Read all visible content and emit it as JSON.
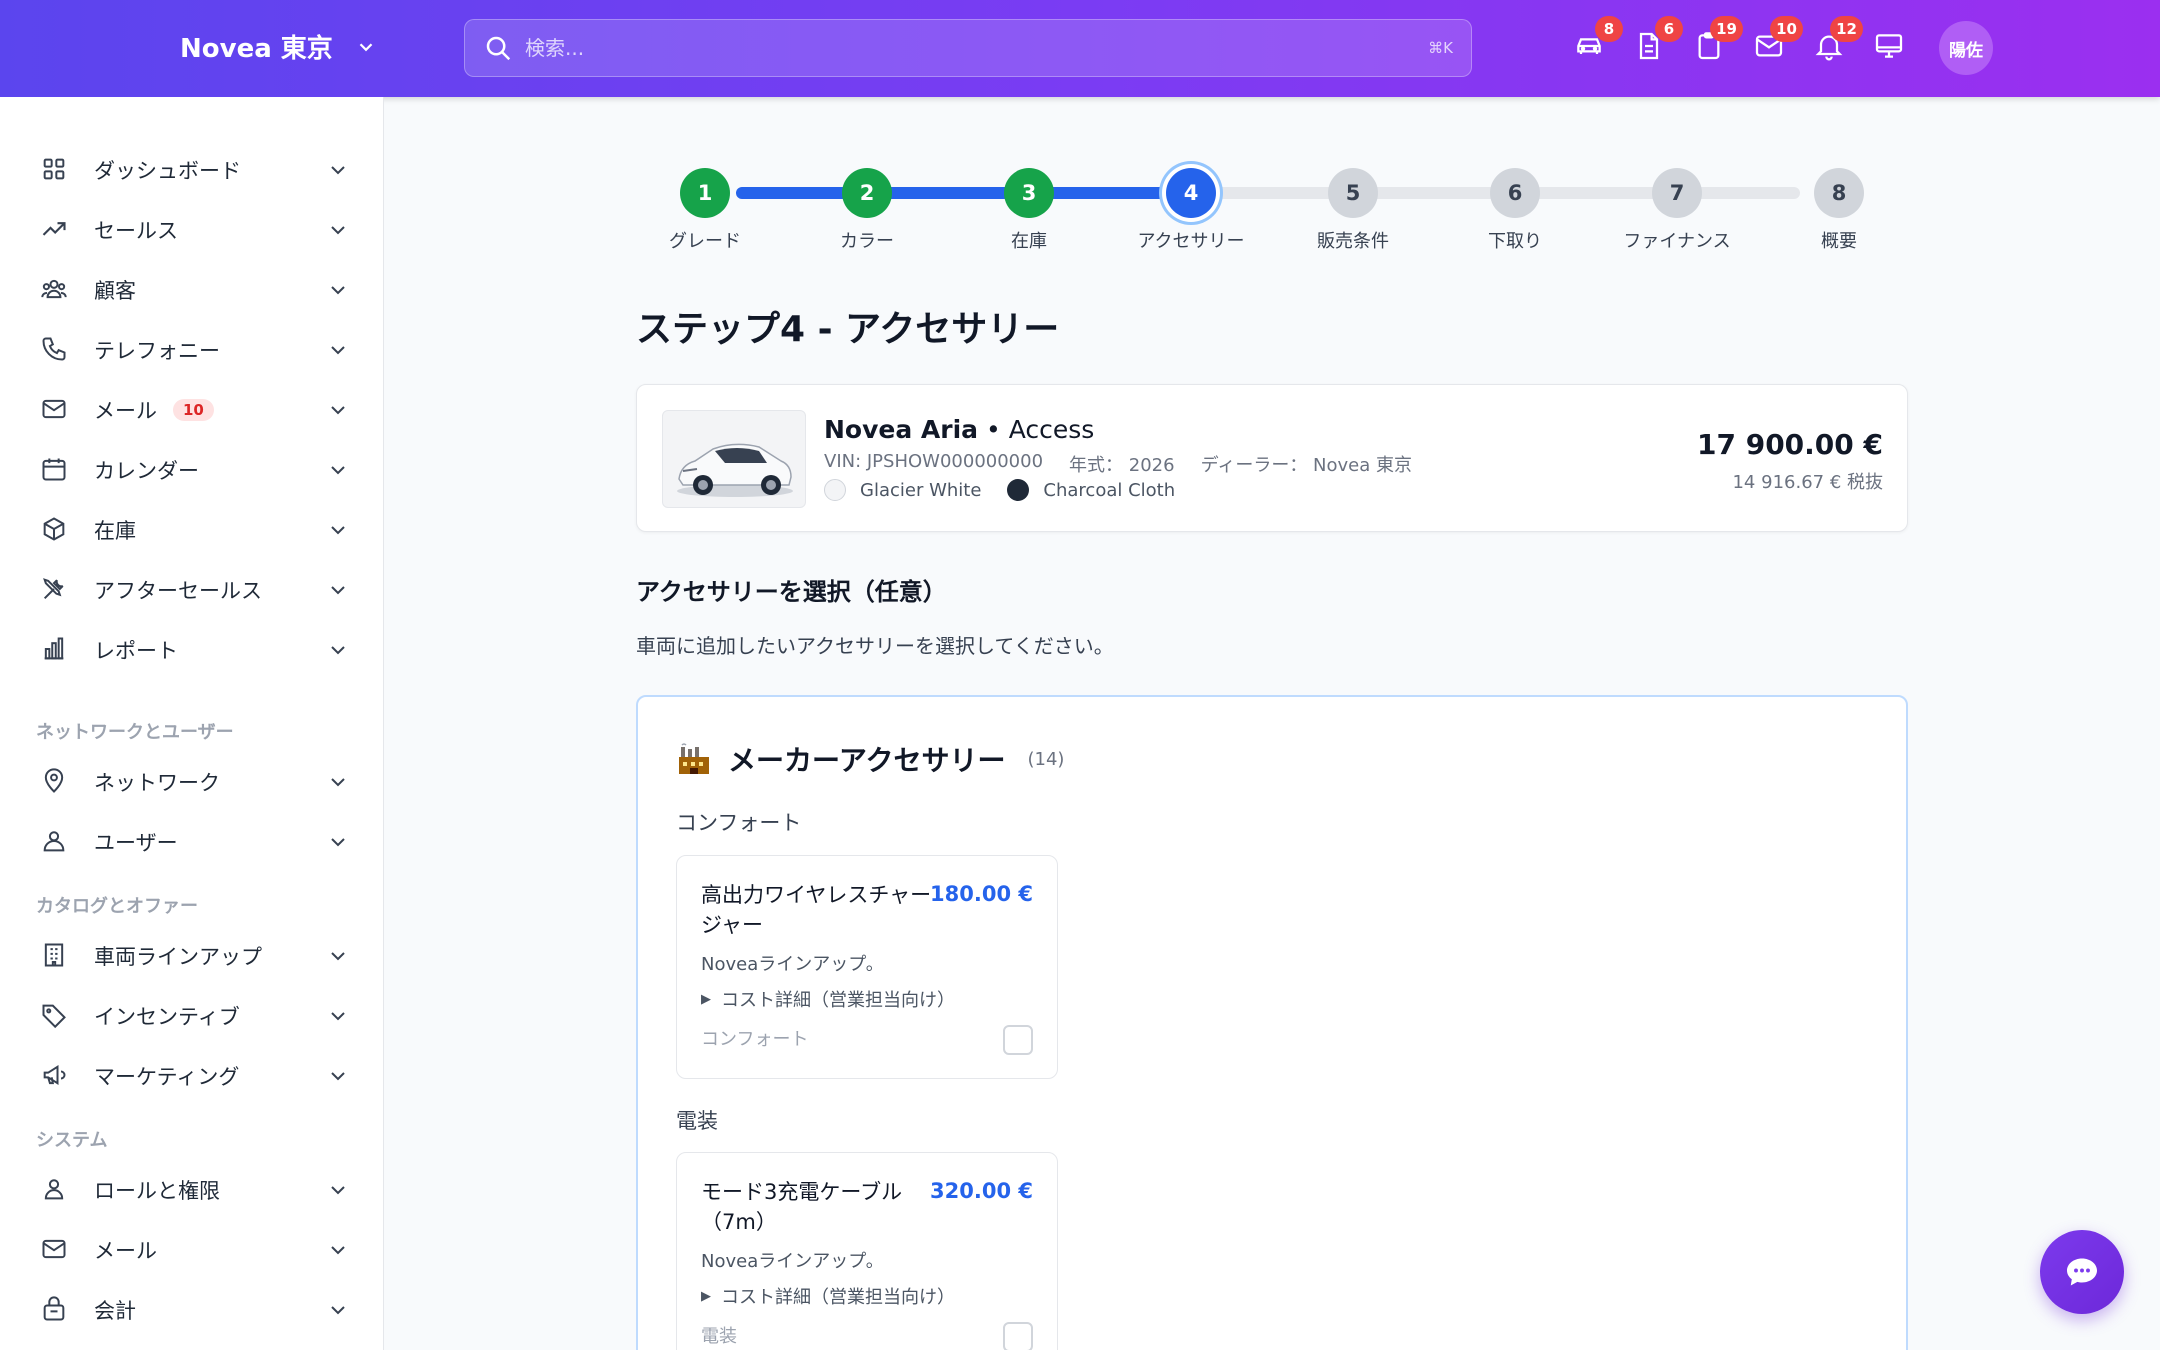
{
  "header": {
    "brand": "Novea 東京",
    "search_placeholder": "検索...",
    "search_shortcut": "⌘K",
    "badges": {
      "car": "8",
      "document": "6",
      "clipboard": "19",
      "mail": "10",
      "bell": "12"
    },
    "avatar": "陽佐"
  },
  "sidebar": {
    "items": [
      {
        "label": "ダッシュボード"
      },
      {
        "label": "セールス"
      },
      {
        "label": "顧客"
      },
      {
        "label": "テレフォニー"
      },
      {
        "label": "メール",
        "badge": "10"
      },
      {
        "label": "カレンダー"
      },
      {
        "label": "在庫"
      },
      {
        "label": "アフターセールス"
      },
      {
        "label": "レポート"
      }
    ],
    "section_network": "ネットワークとユーザー",
    "network_items": [
      {
        "label": "ネットワーク"
      },
      {
        "label": "ユーザー"
      }
    ],
    "section_catalog": "カタログとオファー",
    "catalog_items": [
      {
        "label": "車両ラインアップ"
      },
      {
        "label": "インセンティブ"
      },
      {
        "label": "マーケティング"
      }
    ],
    "section_system": "システム",
    "system_items": [
      {
        "label": "ロールと権限"
      },
      {
        "label": "メール"
      },
      {
        "label": "会計"
      }
    ]
  },
  "stepper": {
    "current": 4,
    "steps": [
      {
        "num": "1",
        "label": "グレード",
        "state": "done"
      },
      {
        "num": "2",
        "label": "カラー",
        "state": "done"
      },
      {
        "num": "3",
        "label": "在庫",
        "state": "done"
      },
      {
        "num": "4",
        "label": "アクセサリー",
        "state": "current"
      },
      {
        "num": "5",
        "label": "販売条件",
        "state": "todo"
      },
      {
        "num": "6",
        "label": "下取り",
        "state": "todo"
      },
      {
        "num": "7",
        "label": "ファイナンス",
        "state": "todo"
      },
      {
        "num": "8",
        "label": "概要",
        "state": "todo"
      }
    ]
  },
  "page_title": "ステップ4 - アクセサリー",
  "vehicle": {
    "model": "Novea Aria",
    "separator": "•",
    "trim": "Access",
    "vin": "VIN: JPSHOW000000000",
    "year": "年式： 2026",
    "dealer": "ディーラー： Novea 東京",
    "exterior_color": "Glacier White",
    "exterior_hex": "#f3f4f6",
    "interior_color": "Charcoal Cloth",
    "interior_hex": "#1f2937",
    "price": "17 900.00 €",
    "price_ex_tax": "14 916.67 € 税抜"
  },
  "accessories": {
    "heading": "アクセサリーを選択（任意）",
    "description": "車両に追加したいアクセサリーを選択してください。",
    "group_title": "メーカーアクセサリー",
    "group_count": "(14)",
    "categories": [
      {
        "label": "コンフォート",
        "item": {
          "name": "高出力ワイヤレスチャージャー",
          "price": "180.00 €",
          "line": "Noveaラインアップ。",
          "details": "コスト詳細（営業担当向け）",
          "tag": "コンフォート",
          "checked": false
        }
      },
      {
        "label": "電装",
        "item": {
          "name": "モード3充電ケーブル（7m）",
          "price": "320.00 €",
          "line": "Noveaラインアップ。",
          "details": "コスト詳細（営業担当向け）",
          "tag": "電装",
          "checked": false
        }
      }
    ]
  },
  "colors": {
    "primary": "#2563eb",
    "success": "#16a34a",
    "accent": "#7c3aed",
    "badge": "#ef4444"
  }
}
